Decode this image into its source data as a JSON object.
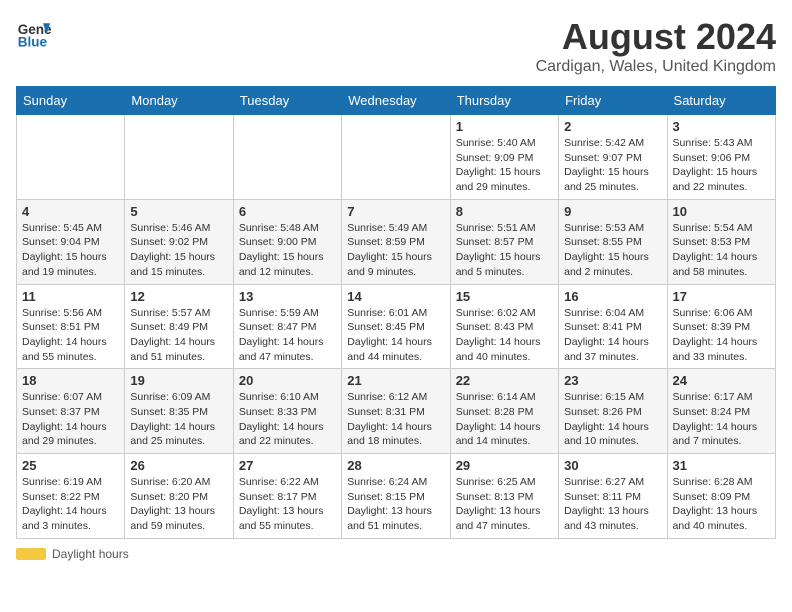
{
  "header": {
    "logo_line1": "General",
    "logo_line2": "Blue",
    "main_title": "August 2024",
    "subtitle": "Cardigan, Wales, United Kingdom"
  },
  "calendar": {
    "weekdays": [
      "Sunday",
      "Monday",
      "Tuesday",
      "Wednesday",
      "Thursday",
      "Friday",
      "Saturday"
    ],
    "weeks": [
      [
        {
          "day": "",
          "sunrise": "",
          "sunset": "",
          "daylight": ""
        },
        {
          "day": "",
          "sunrise": "",
          "sunset": "",
          "daylight": ""
        },
        {
          "day": "",
          "sunrise": "",
          "sunset": "",
          "daylight": ""
        },
        {
          "day": "",
          "sunrise": "",
          "sunset": "",
          "daylight": ""
        },
        {
          "day": "1",
          "sunrise": "Sunrise: 5:40 AM",
          "sunset": "Sunset: 9:09 PM",
          "daylight": "Daylight: 15 hours and 29 minutes."
        },
        {
          "day": "2",
          "sunrise": "Sunrise: 5:42 AM",
          "sunset": "Sunset: 9:07 PM",
          "daylight": "Daylight: 15 hours and 25 minutes."
        },
        {
          "day": "3",
          "sunrise": "Sunrise: 5:43 AM",
          "sunset": "Sunset: 9:06 PM",
          "daylight": "Daylight: 15 hours and 22 minutes."
        }
      ],
      [
        {
          "day": "4",
          "sunrise": "Sunrise: 5:45 AM",
          "sunset": "Sunset: 9:04 PM",
          "daylight": "Daylight: 15 hours and 19 minutes."
        },
        {
          "day": "5",
          "sunrise": "Sunrise: 5:46 AM",
          "sunset": "Sunset: 9:02 PM",
          "daylight": "Daylight: 15 hours and 15 minutes."
        },
        {
          "day": "6",
          "sunrise": "Sunrise: 5:48 AM",
          "sunset": "Sunset: 9:00 PM",
          "daylight": "Daylight: 15 hours and 12 minutes."
        },
        {
          "day": "7",
          "sunrise": "Sunrise: 5:49 AM",
          "sunset": "Sunset: 8:59 PM",
          "daylight": "Daylight: 15 hours and 9 minutes."
        },
        {
          "day": "8",
          "sunrise": "Sunrise: 5:51 AM",
          "sunset": "Sunset: 8:57 PM",
          "daylight": "Daylight: 15 hours and 5 minutes."
        },
        {
          "day": "9",
          "sunrise": "Sunrise: 5:53 AM",
          "sunset": "Sunset: 8:55 PM",
          "daylight": "Daylight: 15 hours and 2 minutes."
        },
        {
          "day": "10",
          "sunrise": "Sunrise: 5:54 AM",
          "sunset": "Sunset: 8:53 PM",
          "daylight": "Daylight: 14 hours and 58 minutes."
        }
      ],
      [
        {
          "day": "11",
          "sunrise": "Sunrise: 5:56 AM",
          "sunset": "Sunset: 8:51 PM",
          "daylight": "Daylight: 14 hours and 55 minutes."
        },
        {
          "day": "12",
          "sunrise": "Sunrise: 5:57 AM",
          "sunset": "Sunset: 8:49 PM",
          "daylight": "Daylight: 14 hours and 51 minutes."
        },
        {
          "day": "13",
          "sunrise": "Sunrise: 5:59 AM",
          "sunset": "Sunset: 8:47 PM",
          "daylight": "Daylight: 14 hours and 47 minutes."
        },
        {
          "day": "14",
          "sunrise": "Sunrise: 6:01 AM",
          "sunset": "Sunset: 8:45 PM",
          "daylight": "Daylight: 14 hours and 44 minutes."
        },
        {
          "day": "15",
          "sunrise": "Sunrise: 6:02 AM",
          "sunset": "Sunset: 8:43 PM",
          "daylight": "Daylight: 14 hours and 40 minutes."
        },
        {
          "day": "16",
          "sunrise": "Sunrise: 6:04 AM",
          "sunset": "Sunset: 8:41 PM",
          "daylight": "Daylight: 14 hours and 37 minutes."
        },
        {
          "day": "17",
          "sunrise": "Sunrise: 6:06 AM",
          "sunset": "Sunset: 8:39 PM",
          "daylight": "Daylight: 14 hours and 33 minutes."
        }
      ],
      [
        {
          "day": "18",
          "sunrise": "Sunrise: 6:07 AM",
          "sunset": "Sunset: 8:37 PM",
          "daylight": "Daylight: 14 hours and 29 minutes."
        },
        {
          "day": "19",
          "sunrise": "Sunrise: 6:09 AM",
          "sunset": "Sunset: 8:35 PM",
          "daylight": "Daylight: 14 hours and 25 minutes."
        },
        {
          "day": "20",
          "sunrise": "Sunrise: 6:10 AM",
          "sunset": "Sunset: 8:33 PM",
          "daylight": "Daylight: 14 hours and 22 minutes."
        },
        {
          "day": "21",
          "sunrise": "Sunrise: 6:12 AM",
          "sunset": "Sunset: 8:31 PM",
          "daylight": "Daylight: 14 hours and 18 minutes."
        },
        {
          "day": "22",
          "sunrise": "Sunrise: 6:14 AM",
          "sunset": "Sunset: 8:28 PM",
          "daylight": "Daylight: 14 hours and 14 minutes."
        },
        {
          "day": "23",
          "sunrise": "Sunrise: 6:15 AM",
          "sunset": "Sunset: 8:26 PM",
          "daylight": "Daylight: 14 hours and 10 minutes."
        },
        {
          "day": "24",
          "sunrise": "Sunrise: 6:17 AM",
          "sunset": "Sunset: 8:24 PM",
          "daylight": "Daylight: 14 hours and 7 minutes."
        }
      ],
      [
        {
          "day": "25",
          "sunrise": "Sunrise: 6:19 AM",
          "sunset": "Sunset: 8:22 PM",
          "daylight": "Daylight: 14 hours and 3 minutes."
        },
        {
          "day": "26",
          "sunrise": "Sunrise: 6:20 AM",
          "sunset": "Sunset: 8:20 PM",
          "daylight": "Daylight: 13 hours and 59 minutes."
        },
        {
          "day": "27",
          "sunrise": "Sunrise: 6:22 AM",
          "sunset": "Sunset: 8:17 PM",
          "daylight": "Daylight: 13 hours and 55 minutes."
        },
        {
          "day": "28",
          "sunrise": "Sunrise: 6:24 AM",
          "sunset": "Sunset: 8:15 PM",
          "daylight": "Daylight: 13 hours and 51 minutes."
        },
        {
          "day": "29",
          "sunrise": "Sunrise: 6:25 AM",
          "sunset": "Sunset: 8:13 PM",
          "daylight": "Daylight: 13 hours and 47 minutes."
        },
        {
          "day": "30",
          "sunrise": "Sunrise: 6:27 AM",
          "sunset": "Sunset: 8:11 PM",
          "daylight": "Daylight: 13 hours and 43 minutes."
        },
        {
          "day": "31",
          "sunrise": "Sunrise: 6:28 AM",
          "sunset": "Sunset: 8:09 PM",
          "daylight": "Daylight: 13 hours and 40 minutes."
        }
      ]
    ]
  },
  "footer": {
    "daylight_label": "Daylight hours"
  }
}
